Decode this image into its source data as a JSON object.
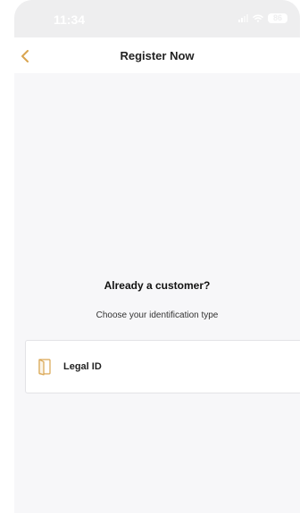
{
  "status_bar": {
    "time": "11:34",
    "battery": "86",
    "icons": [
      "signal-icon",
      "wifi-icon",
      "battery-icon"
    ]
  },
  "nav": {
    "back_icon": "chevron-left-icon",
    "title": "Register Now"
  },
  "content": {
    "question": "Already a customer?",
    "subtitle": "Choose your identification type",
    "options": [
      {
        "label": "Legal ID",
        "icon": "id-card-icon"
      }
    ]
  },
  "colors": {
    "accent": "#d9a550",
    "screen_background": "#f7f7f9",
    "card_background": "#ffffff",
    "card_border": "#e3e3e6"
  }
}
